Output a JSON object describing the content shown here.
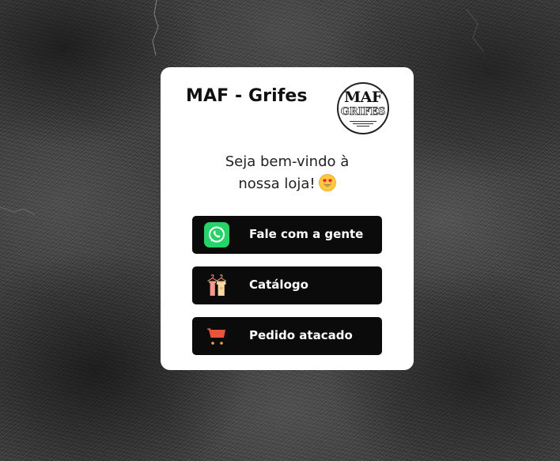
{
  "card": {
    "title": "MAF - Grifes",
    "logo": {
      "main_text": "MAF",
      "sub_text": "GRIFES",
      "icon": "maf-grifes-logo"
    },
    "welcome_line1": "Seja bem-vindo à",
    "welcome_line2": "nossa loja!",
    "welcome_emoji": "heart-eyes-emoji"
  },
  "buttons": [
    {
      "label": "Fale com a gente",
      "icon": "whatsapp-icon",
      "color": "#25D366"
    },
    {
      "label": "Catálogo",
      "icon": "clothes-hanger-icon",
      "color": "#F4A582"
    },
    {
      "label": "Pedido atacado",
      "icon": "shopping-cart-icon",
      "color": "#E8553A"
    }
  ],
  "colors": {
    "card_background": "#ffffff",
    "button_background": "#0b0b0b",
    "button_text": "#ffffff",
    "title_text": "#111111"
  }
}
